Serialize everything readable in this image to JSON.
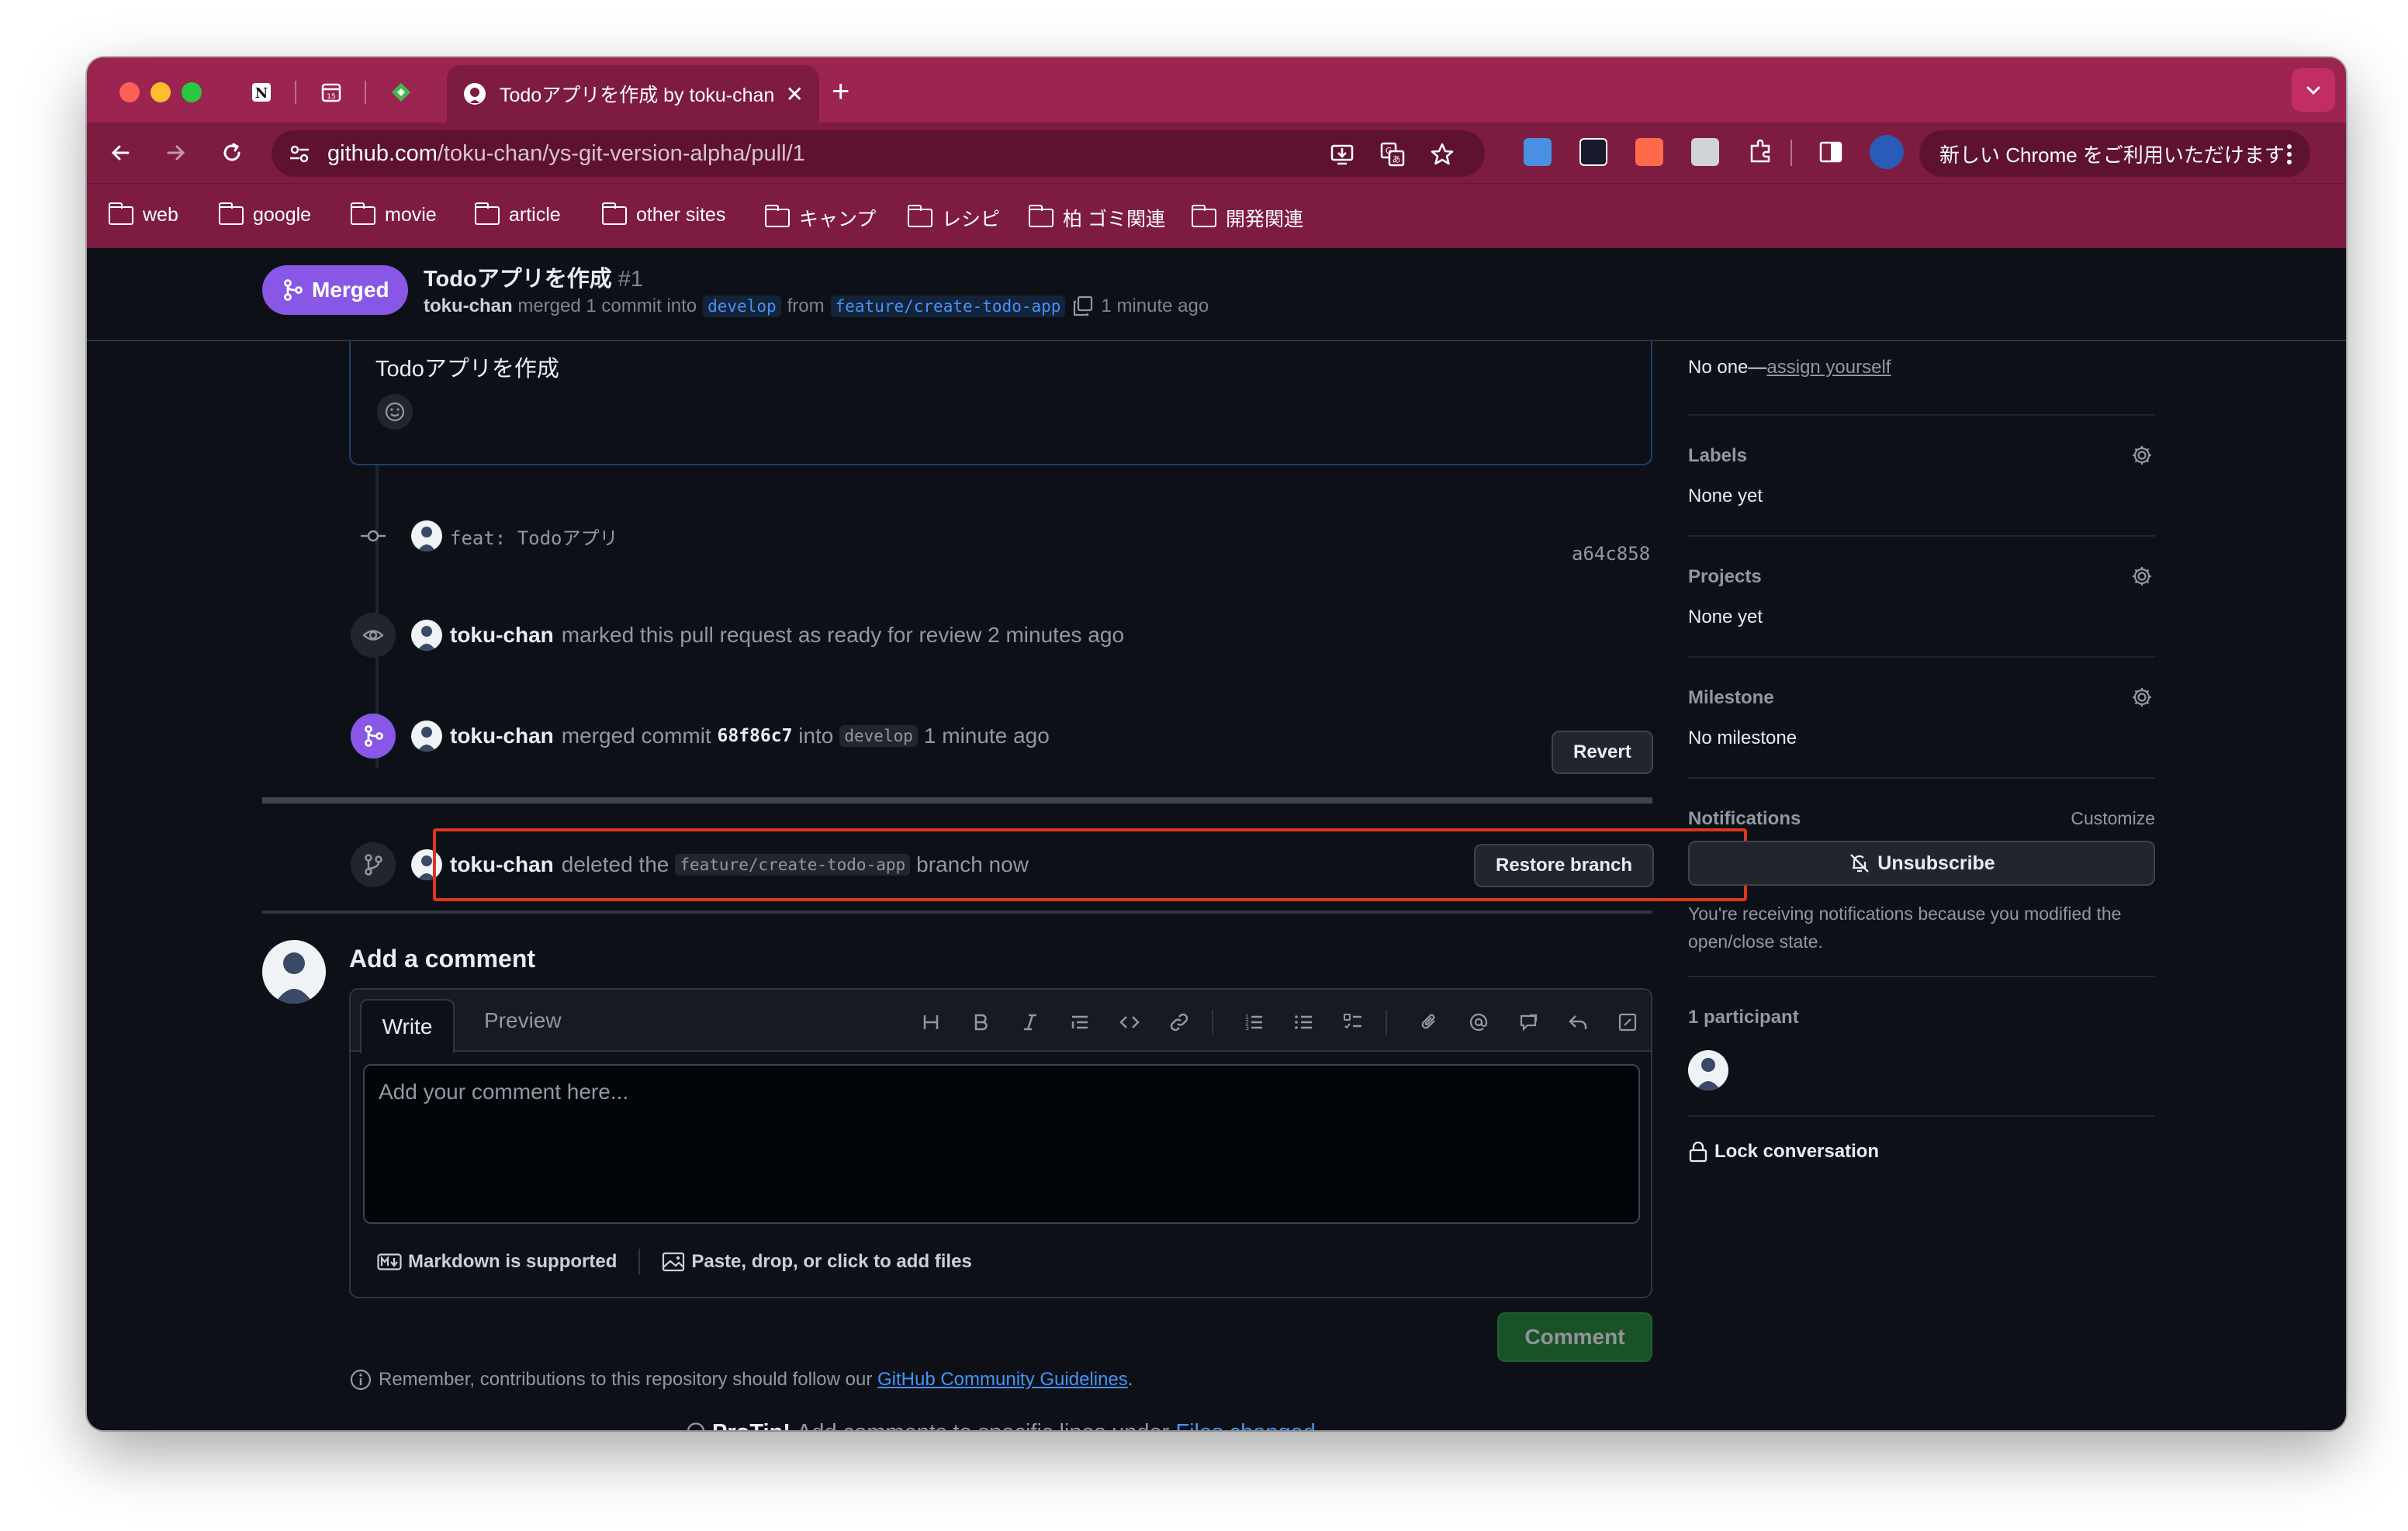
{
  "browser": {
    "active_tab_title": "Todoアプリを作成 by toku-chan",
    "tab_close": "✕",
    "new_tab": "+",
    "url_host": "github.com",
    "url_path": "/toku-chan/ys-git-version-alpha/pull/1",
    "update_label": "新しい Chrome をご利用いただけます",
    "bookmarks": [
      "web",
      "google",
      "movie",
      "article",
      "other sites",
      "キャンプ",
      "レシピ",
      "柏 ゴミ関連",
      "開発関連"
    ],
    "colors": {
      "frame": "#9b2451",
      "toolbar": "#7e1b41"
    }
  },
  "pr": {
    "state": "Merged",
    "title": "Todoアプリを作成",
    "number": "#1",
    "author": "toku-chan",
    "merged_text": "merged 1 commit into",
    "base_branch": "develop",
    "from_text": "from",
    "head_branch": "feature/create-todo-app",
    "time": "1 minute ago"
  },
  "body": {
    "text": "Todoアプリを作成"
  },
  "timeline": {
    "commit": {
      "message": "feat: Todoアプリ",
      "sha": "a64c858"
    },
    "ready": {
      "user": "toku-chan",
      "text": "marked this pull request as ready for review 2 minutes ago"
    },
    "merged": {
      "user": "toku-chan",
      "text": "merged commit",
      "sha": "68f86c7",
      "into": "into",
      "branch": "develop",
      "time": "1 minute ago",
      "button": "Revert"
    },
    "deleted": {
      "user": "toku-chan",
      "text": "deleted the",
      "branch": "feature/create-todo-app",
      "suffix": "branch now",
      "button": "Restore branch"
    }
  },
  "comment": {
    "heading": "Add a comment",
    "tab_write": "Write",
    "tab_preview": "Preview",
    "placeholder": "Add your comment here...",
    "markdown": "Markdown is supported",
    "attach": "Paste, drop, or click to add files",
    "submit": "Comment",
    "guidelines_prefix": "Remember, contributions to this repository should follow our",
    "guidelines_link": "GitHub Community Guidelines",
    "guidelines_suffix": ".",
    "protip_label": "ProTip!",
    "protip_text": "Add comments to specific lines under",
    "protip_link": "Files changed",
    "protip_suffix": "."
  },
  "sidebar": {
    "assignees_value_prefix": "No one—",
    "assignees_link": "assign yourself",
    "labels_h": "Labels",
    "labels_v": "None yet",
    "projects_h": "Projects",
    "projects_v": "None yet",
    "milestone_h": "Milestone",
    "milestone_v": "No milestone",
    "notifications_h": "Notifications",
    "customize": "Customize",
    "unsubscribe": "Unsubscribe",
    "notif_text": "You're receiving notifications because you modified the open/close state.",
    "participants_h": "1 participant",
    "lock": "Lock conversation"
  }
}
